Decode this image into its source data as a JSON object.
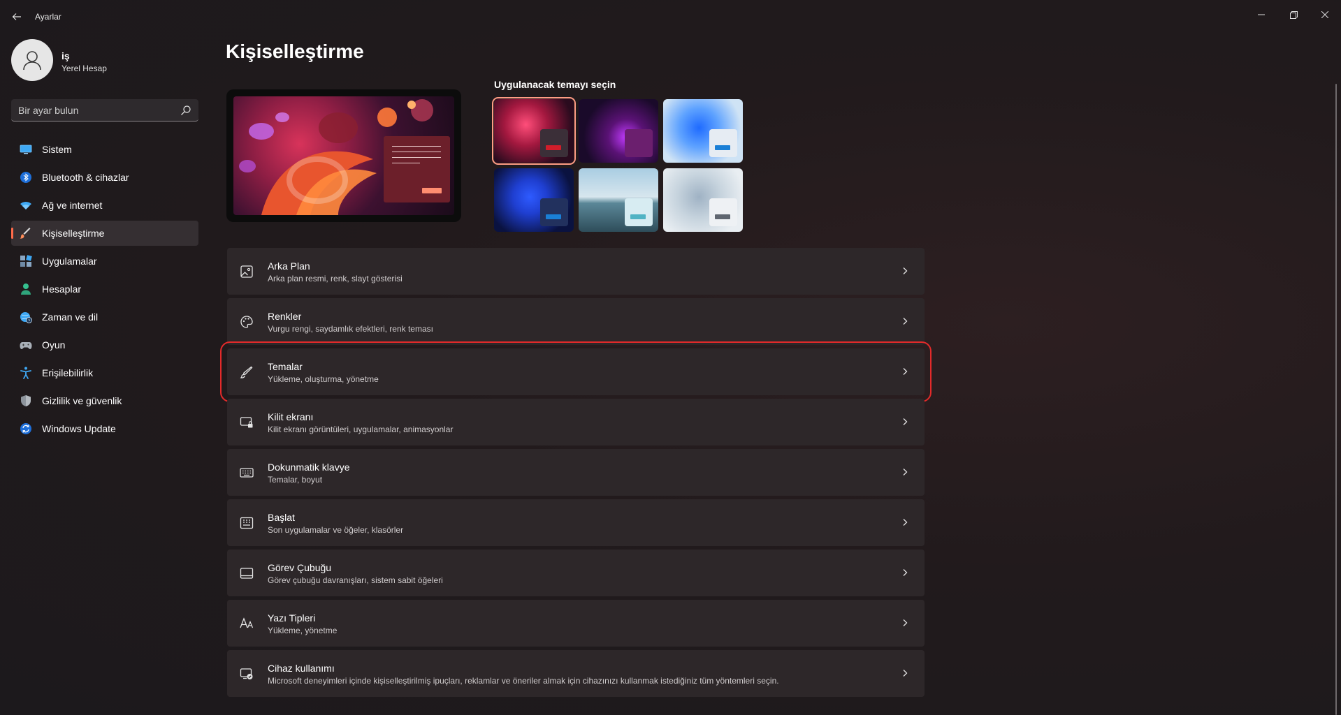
{
  "window": {
    "title": "Ayarlar"
  },
  "profile": {
    "name": "iş",
    "account_type": "Yerel Hesap"
  },
  "search": {
    "placeholder": "Bir ayar bulun",
    "icon": "search-icon"
  },
  "sidebar": {
    "items": [
      {
        "label": "Sistem",
        "icon": "monitor-icon",
        "active": false
      },
      {
        "label": "Bluetooth & cihazlar",
        "icon": "bluetooth-icon",
        "active": false
      },
      {
        "label": "Ağ ve internet",
        "icon": "wifi-icon",
        "active": false
      },
      {
        "label": "Kişiselleştirme",
        "icon": "brush-icon",
        "active": true
      },
      {
        "label": "Uygulamalar",
        "icon": "apps-icon",
        "active": false
      },
      {
        "label": "Hesaplar",
        "icon": "person-icon",
        "active": false
      },
      {
        "label": "Zaman ve dil",
        "icon": "globe-clock-icon",
        "active": false
      },
      {
        "label": "Oyun",
        "icon": "gamepad-icon",
        "active": false
      },
      {
        "label": "Erişilebilirlik",
        "icon": "accessibility-icon",
        "active": false
      },
      {
        "label": "Gizlilik ve güvenlik",
        "icon": "shield-icon",
        "active": false
      },
      {
        "label": "Windows Update",
        "icon": "update-icon",
        "active": false
      }
    ]
  },
  "main": {
    "title": "Kişiselleştirme",
    "themes_heading": "Uygulanacak temayı seçin",
    "settings": [
      {
        "title": "Arka Plan",
        "desc": "Arka plan resmi, renk, slayt gösterisi",
        "icon": "image-icon"
      },
      {
        "title": "Renkler",
        "desc": "Vurgu rengi, saydamlık efektleri, renk teması",
        "icon": "palette-icon"
      },
      {
        "title": "Temalar",
        "desc": "Yükleme, oluşturma, yönetme",
        "icon": "pen-icon"
      },
      {
        "title": "Kilit ekranı",
        "desc": "Kilit ekranı görüntüleri, uygulamalar, animasyonlar",
        "icon": "lock-screen-icon"
      },
      {
        "title": "Dokunmatik klavye",
        "desc": "Temalar, boyut",
        "icon": "keyboard-icon"
      },
      {
        "title": "Başlat",
        "desc": "Son uygulamalar ve öğeler, klasörler",
        "icon": "start-grid-icon"
      },
      {
        "title": "Görev Çubuğu",
        "desc": "Görev çubuğu davranışları, sistem sabit öğeleri",
        "icon": "taskbar-icon"
      },
      {
        "title": "Yazı Tipleri",
        "desc": "Yükleme, yönetme",
        "icon": "font-icon"
      },
      {
        "title": "Cihaz kullanımı",
        "desc": "Microsoft deneyimleri içinde kişiselleştirilmiş ipuçları, reklamlar ve öneriler almak için cihazınızı kullanmak istediğiniz tüm yöntemleri seçin.",
        "icon": "device-usage-icon"
      }
    ]
  },
  "colors": {
    "accent": "#ff6b4a",
    "highlight_box": "#e32a2a",
    "card_bg": "#2d2729",
    "theme_chips": [
      "#d11d2a",
      "#6b1f6e",
      "#1a7fd6",
      "#1a7fd6",
      "#4fb3c4",
      "#5f6670"
    ]
  }
}
